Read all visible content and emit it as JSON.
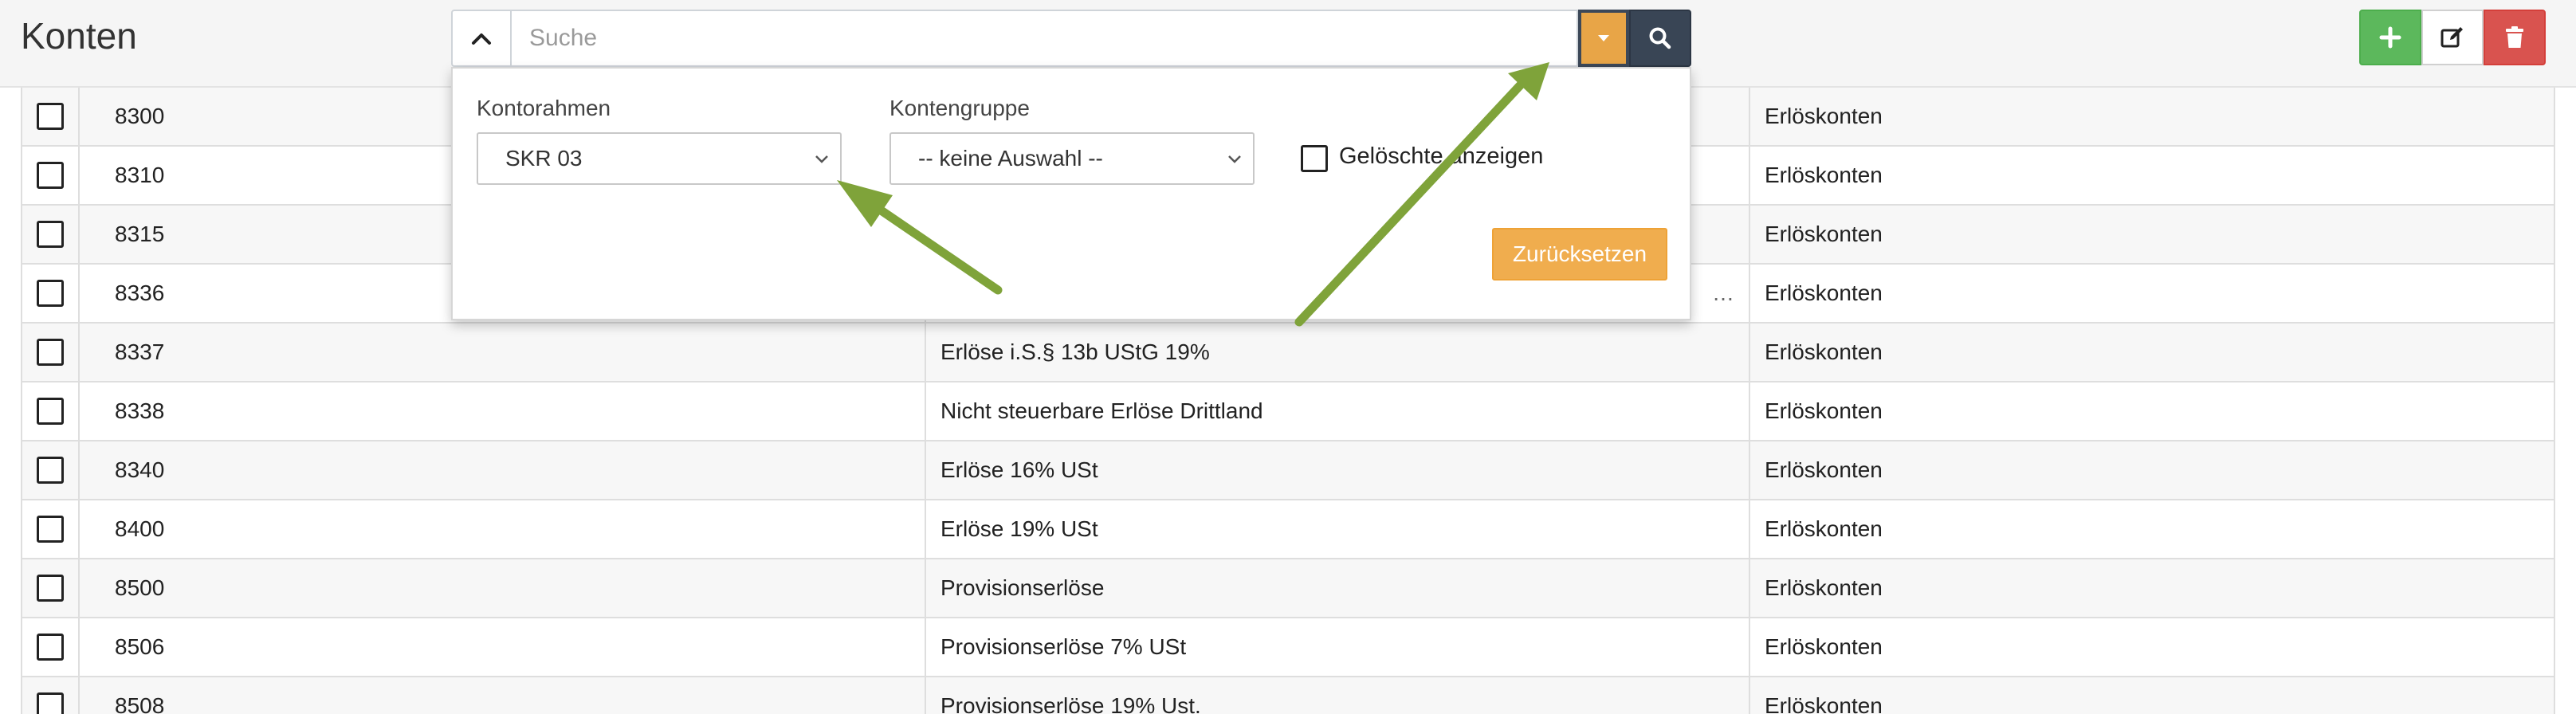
{
  "header": {
    "title": "Konten",
    "search_placeholder": "Suche",
    "search_value": ""
  },
  "filter": {
    "kontorahmen_label": "Kontorahmen",
    "kontorahmen_value": "SKR 03",
    "kontengruppe_label": "Kontengruppe",
    "kontengruppe_value": "-- keine Auswahl --",
    "deleted_label": "Gelöschte anzeigen",
    "deleted_checked": false,
    "reset_label": "Zurücksetzen"
  },
  "table": {
    "rows": [
      {
        "number": "8300",
        "name": "",
        "group": "Erlöskonten"
      },
      {
        "number": "8310",
        "name": "",
        "group": "Erlöskonten"
      },
      {
        "number": "8315",
        "name": "",
        "group": "Erlöskonten"
      },
      {
        "number": "8336",
        "name": "…",
        "group": "Erlöskonten"
      },
      {
        "number": "8337",
        "name": "Erlöse i.S.§ 13b UStG 19%",
        "group": "Erlöskonten"
      },
      {
        "number": "8338",
        "name": "Nicht steuerbare Erlöse Drittland",
        "group": "Erlöskonten"
      },
      {
        "number": "8340",
        "name": "Erlöse 16% USt",
        "group": "Erlöskonten"
      },
      {
        "number": "8400",
        "name": "Erlöse 19% USt",
        "group": "Erlöskonten"
      },
      {
        "number": "8500",
        "name": "Provisionserlöse",
        "group": "Erlöskonten"
      },
      {
        "number": "8506",
        "name": "Provisionserlöse 7% USt",
        "group": "Erlöskonten"
      },
      {
        "number": "8508",
        "name": "Provisionserlöse 19% Ust.",
        "group": "Erlöskonten"
      }
    ]
  },
  "icons": {
    "collapse": "chevron-up-icon",
    "dropdown": "caret-down-icon",
    "search": "search-icon",
    "add": "plus-icon",
    "edit": "edit-icon",
    "delete": "trash-icon"
  },
  "colors": {
    "dropdown_button": "#e8a547",
    "search_button": "#394555",
    "add_button": "#5cb85c",
    "delete_button": "#d9534f",
    "reset_button": "#f0ad4e",
    "annotation_arrow": "#7fa33a"
  }
}
